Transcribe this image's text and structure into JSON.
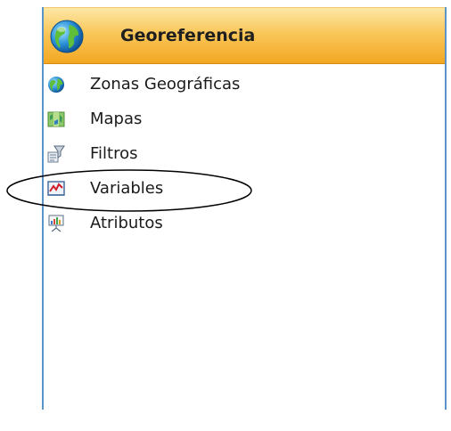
{
  "panel": {
    "title": "Georeferencia",
    "header_icon": "globe-icon",
    "items": [
      {
        "label": "Zonas Geográficas",
        "icon": "globe-icon"
      },
      {
        "label": "Mapas",
        "icon": "map-icon"
      },
      {
        "label": "Filtros",
        "icon": "filter-icon"
      },
      {
        "label": "Variables",
        "icon": "line-chart-icon"
      },
      {
        "label": "Atributos",
        "icon": "presentation-board-icon"
      }
    ]
  },
  "colors": {
    "header_top": "#fde7a6",
    "header_bottom": "#f3a722",
    "panel_border": "#5b94c8",
    "annotation_oval": "#000000"
  }
}
